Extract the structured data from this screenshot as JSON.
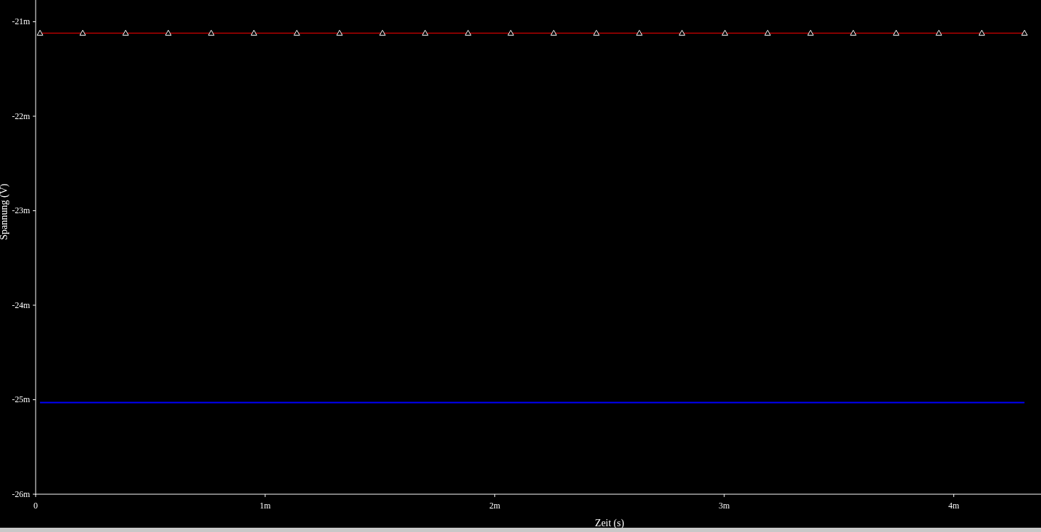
{
  "plot": {
    "chart_data": {
      "type": "line",
      "xlabel": "Zeit (s)",
      "ylabel": "Spannung (V)",
      "x": [
        0.019,
        0.205,
        0.392,
        0.578,
        0.765,
        0.951,
        1.138,
        1.324,
        1.511,
        1.697,
        1.884,
        2.07,
        2.257,
        2.443,
        2.63,
        2.816,
        3.003,
        3.189,
        3.376,
        3.562,
        3.749,
        3.935,
        4.122,
        4.308
      ],
      "series": [
        {
          "color": "#ff0000",
          "marker": "triangle",
          "values": [
            -21.12,
            -21.12,
            -21.12,
            -21.12,
            -21.12,
            -21.12,
            -21.12,
            -21.12,
            -21.12,
            -21.12,
            -21.12,
            -21.12,
            -21.12,
            -21.12,
            -21.12,
            -21.12,
            -21.12,
            -21.12,
            -21.12,
            -21.12,
            -21.12,
            -21.12,
            -21.12,
            -21.12
          ]
        },
        {
          "color": "#0000ff",
          "values": [
            -25.03,
            -25.03,
            -25.03,
            -25.03,
            -25.03,
            -25.03,
            -25.03,
            -25.03,
            -25.03,
            -25.03,
            -25.03,
            -25.03,
            -25.03,
            -25.03,
            -25.03,
            -25.03,
            -25.03,
            -25.03,
            -25.03,
            -25.03,
            -25.03,
            -25.03,
            -25.03,
            -25.03
          ]
        }
      ],
      "xlim": [
        0,
        4.38
      ],
      "ylim": [
        -26,
        -20.77
      ],
      "xticks": [
        {
          "value": 0,
          "label": "0"
        },
        {
          "value": 1,
          "label": "1m"
        },
        {
          "value": 2,
          "label": "2m"
        },
        {
          "value": 3,
          "label": "3m"
        },
        {
          "value": 4,
          "label": "4m"
        }
      ],
      "yticks": [
        {
          "value": -21,
          "label": "-21m"
        },
        {
          "value": -22,
          "label": "-22m"
        },
        {
          "value": -23,
          "label": "-23m"
        },
        {
          "value": -24,
          "label": "-24m"
        },
        {
          "value": -25,
          "label": "-25m"
        },
        {
          "value": -26,
          "label": "-26m"
        }
      ]
    }
  }
}
